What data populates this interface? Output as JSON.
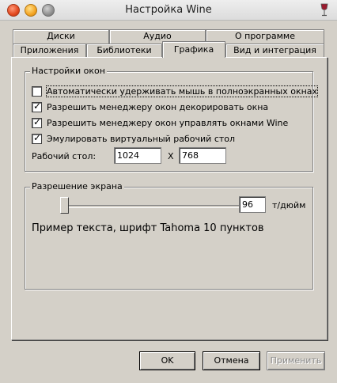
{
  "window": {
    "title": "Настройка Wine"
  },
  "tabs_row_back": [
    {
      "label": "Диски"
    },
    {
      "label": "Аудио"
    },
    {
      "label": "О программе"
    }
  ],
  "tabs_row_front": [
    {
      "label": "Приложения"
    },
    {
      "label": "Библиотеки"
    },
    {
      "label": "Графика",
      "active": true
    },
    {
      "label": "Вид и интеграция"
    }
  ],
  "window_settings": {
    "title": "Настройки окон",
    "options": [
      {
        "label": "Автоматически удерживать мышь в полноэкранных окнах",
        "checked": false
      },
      {
        "label": "Разрешить менеджеру окон декорировать окна",
        "checked": true
      },
      {
        "label": "Разрешить менеджеру окон управлять окнами Wine",
        "checked": true
      },
      {
        "label": "Эмулировать виртуальный рабочий стол",
        "checked": true
      }
    ],
    "desktop_label": "Рабочий стол:",
    "width": "1024",
    "x_sep": "X",
    "height": "768",
    "check_mark": "✓"
  },
  "screen_resolution": {
    "title": "Разрешение экрана",
    "dpi_value": "96",
    "dpi_unit": "т/дюйм",
    "sample_text": "Пример текста, шрифт Tahoma 10 пунктов"
  },
  "buttons": {
    "ok": "OK",
    "cancel": "Отмена",
    "apply": "Применить"
  }
}
